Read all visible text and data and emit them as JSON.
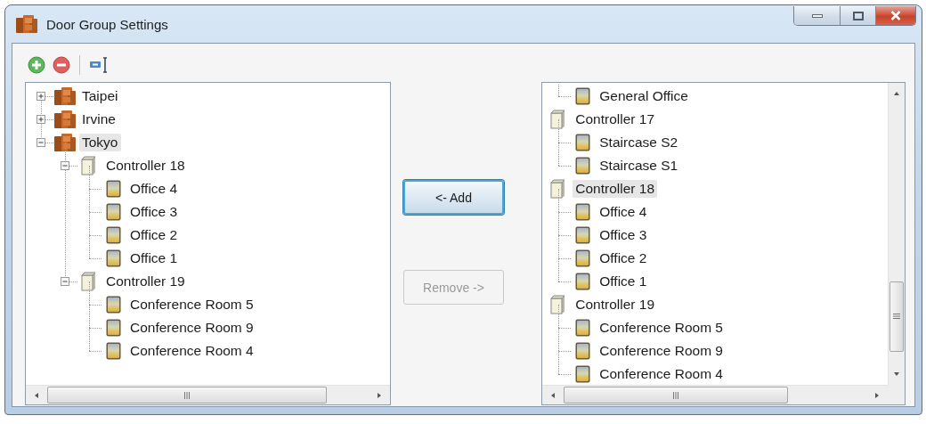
{
  "window": {
    "title": "Door Group Settings"
  },
  "left_tree": {
    "items": [
      {
        "label": "Taipei",
        "kind": "site",
        "expanded": false,
        "selected": false
      },
      {
        "label": "Irvine",
        "kind": "site",
        "expanded": false,
        "selected": false
      },
      {
        "label": "Tokyo",
        "kind": "site",
        "expanded": true,
        "selected": true,
        "children": [
          {
            "label": "Controller 18",
            "kind": "controller",
            "expanded": true,
            "selected": false,
            "children": [
              {
                "label": "Office 4",
                "kind": "door",
                "selected": false
              },
              {
                "label": "Office 3",
                "kind": "door",
                "selected": false
              },
              {
                "label": "Office 2",
                "kind": "door",
                "selected": false
              },
              {
                "label": "Office 1",
                "kind": "door",
                "selected": false
              }
            ]
          },
          {
            "label": "Controller 19",
            "kind": "controller",
            "expanded": true,
            "selected": false,
            "children": [
              {
                "label": "Conference Room 5",
                "kind": "door",
                "selected": false
              },
              {
                "label": "Conference Room 9",
                "kind": "door",
                "selected": false
              },
              {
                "label": "Conference Room 4",
                "kind": "door",
                "selected": false
              }
            ]
          }
        ]
      }
    ]
  },
  "buttons": [
    {
      "label": "<- Add",
      "disabled": false,
      "focused": true
    },
    {
      "label": "Remove ->",
      "disabled": true,
      "focused": false
    }
  ],
  "right_tree": {
    "items": [
      {
        "children": [
          {
            "label": "General Office",
            "kind": "door",
            "selected": false
          }
        ]
      },
      {
        "label": "Controller 17",
        "kind": "controller",
        "selected": false,
        "children": [
          {
            "label": "Staircase S2",
            "kind": "door",
            "selected": false
          },
          {
            "label": "Staircase S1",
            "kind": "door",
            "selected": false
          }
        ]
      },
      {
        "label": "Controller 18",
        "kind": "controller",
        "selected": true,
        "children": [
          {
            "label": "Office 4",
            "kind": "door",
            "selected": false
          },
          {
            "label": "Office 3",
            "kind": "door",
            "selected": false
          },
          {
            "label": "Office 2",
            "kind": "door",
            "selected": false
          },
          {
            "label": "Office 1",
            "kind": "door",
            "selected": false
          }
        ]
      },
      {
        "label": "Controller 19",
        "kind": "controller",
        "selected": false,
        "children": [
          {
            "label": "Conference Room 5",
            "kind": "door",
            "selected": false
          },
          {
            "label": "Conference Room 9",
            "kind": "door",
            "selected": false
          },
          {
            "label": "Conference Room 4",
            "kind": "door",
            "selected": false
          }
        ]
      }
    ]
  }
}
